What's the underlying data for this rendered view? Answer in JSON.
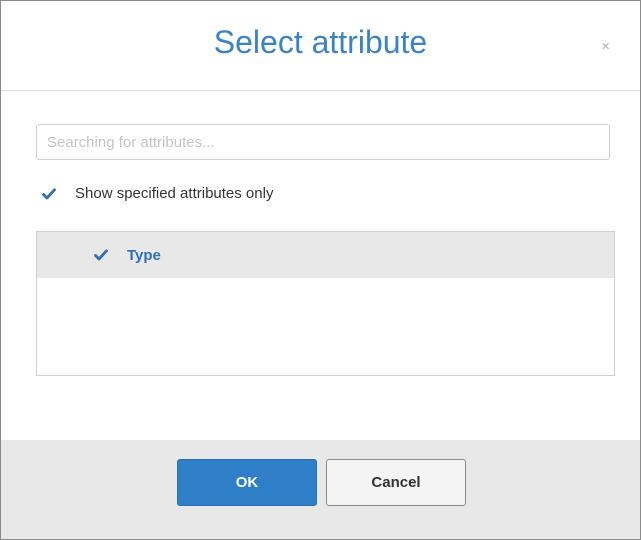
{
  "dialog": {
    "title": "Select attribute",
    "close_symbol": "×"
  },
  "search": {
    "value": "",
    "placeholder": "Searching for attributes..."
  },
  "filter": {
    "label": "Show specified attributes only",
    "checked": true
  },
  "attributes": [
    {
      "label": "Type",
      "checked": true
    }
  ],
  "buttons": {
    "ok_label": "OK",
    "cancel_label": "Cancel"
  },
  "colors": {
    "accent": "#3b82c6",
    "primary_button": "#2f7fc8",
    "footer_bg": "#e8e8e8",
    "row_bg": "#e8e8e8"
  },
  "icons": {
    "close": "close-icon",
    "check": "checkmark-icon"
  }
}
